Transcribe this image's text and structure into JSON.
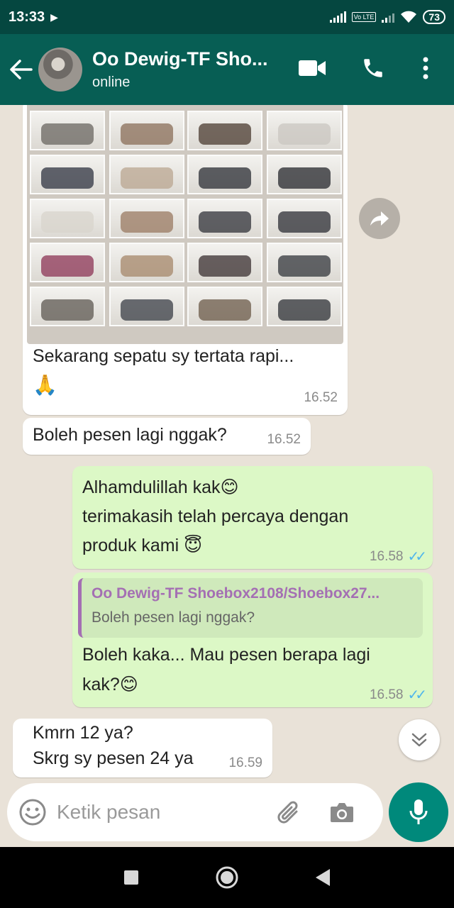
{
  "status_bar": {
    "time": "13:33",
    "battery": "73",
    "network_badge": "Vo LTE"
  },
  "header": {
    "contact_name": "Oo Dewig-TF Sho...",
    "contact_status": "online"
  },
  "messages": [
    {
      "direction": "incoming",
      "type": "image",
      "caption_line1": "Sekarang sepatu sy tertata rapi...",
      "caption_line2": "🙏",
      "time": "16.52"
    },
    {
      "direction": "incoming",
      "text": "Boleh pesen lagi nggak?",
      "time": "16.52"
    },
    {
      "direction": "outgoing",
      "line1": "Alhamdulillah kak😊",
      "line2": "terimakasih telah percaya dengan",
      "line3": "produk kami 😇",
      "time": "16.58",
      "status": "read"
    },
    {
      "direction": "outgoing",
      "reply_to": {
        "name": "Oo Dewig-TF Shoebox2108/Shoebox27...",
        "text": "Boleh pesen lagi nggak?"
      },
      "line1": "Boleh kaka... Mau pesen berapa lagi",
      "line2": "kak?😊",
      "time": "16.58",
      "status": "read"
    },
    {
      "direction": "incoming",
      "line1": "Kmrn 12 ya?",
      "line2": "Skrg sy pesen 24 ya",
      "time": "16.59"
    }
  ],
  "input": {
    "placeholder": "Ketik pesan"
  },
  "colors": {
    "header": "#075e54",
    "status_bar": "#054740",
    "outgoing_bubble": "#dcf8c6",
    "incoming_bubble": "#ffffff",
    "accent": "#00897b",
    "read_ticks": "#4fb6ec"
  },
  "icons": [
    "back-arrow-icon",
    "video-call-icon",
    "phone-icon",
    "more-vert-icon",
    "forward-icon",
    "double-check-icon",
    "chevron-down-icon",
    "emoji-icon",
    "attach-icon",
    "camera-icon",
    "mic-icon",
    "nav-square-icon",
    "nav-circle-icon",
    "nav-back-icon"
  ]
}
